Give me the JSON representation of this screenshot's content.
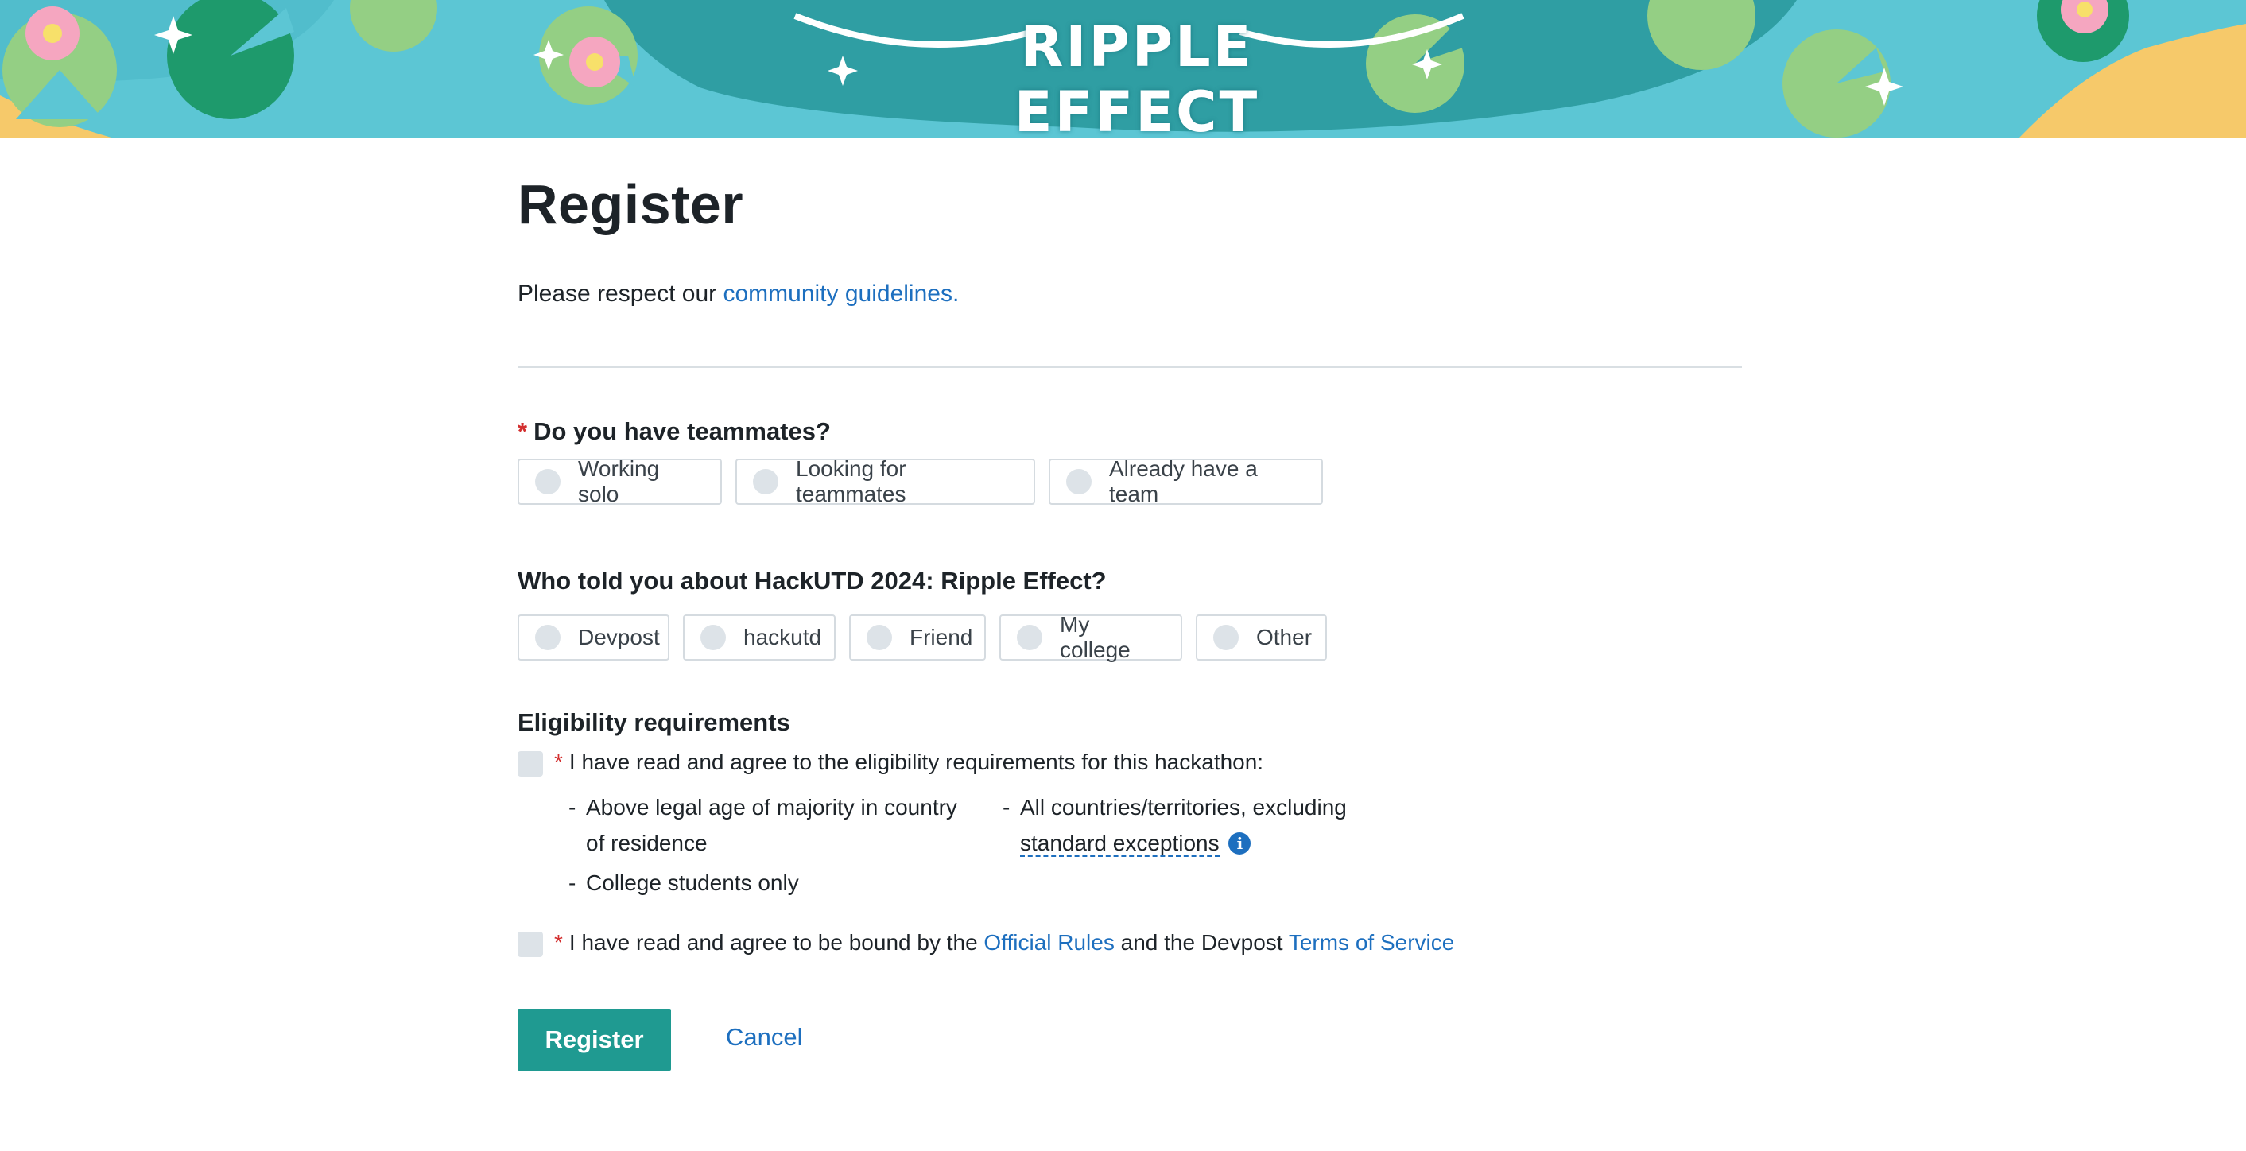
{
  "banner": {
    "title": "RIPPLE EFFECT",
    "colors": {
      "water": "#5cc6d4",
      "deep_water": "#2f9ea3",
      "lily_pad": "#94cf84",
      "lily_pad_dark": "#1e9a6c",
      "sand": "#f6c96a",
      "flower": "#f5a6c0"
    }
  },
  "page": {
    "title": "Register",
    "intro_text": "Please respect our ",
    "intro_link": "community guidelines."
  },
  "teammates": {
    "required_marker": "*",
    "label": "Do you have teammates?",
    "options": [
      "Working solo",
      "Looking for teammates",
      "Already have a team"
    ]
  },
  "referral": {
    "label": "Who told you about HackUTD 2024: Ripple Effect?",
    "options": [
      "Devpost",
      "hackutd",
      "Friend",
      "My college",
      "Other"
    ]
  },
  "eligibility": {
    "heading": "Eligibility requirements",
    "required_marker": "*",
    "agree_text": "I have read and agree to the eligibility requirements for this hackathon:",
    "dash": "-",
    "req_age_line1": "Above legal age of majority in country",
    "req_age_line2": "of residence",
    "req_students": "College students only",
    "req_countries_line1": "All countries/territories, excluding",
    "req_countries_link": "standard exceptions",
    "info_icon_glyph": "i",
    "rules_text_1": "I have read and agree to be bound by the ",
    "rules_link": "Official Rules",
    "rules_text_2": " and the Devpost ",
    "tos_link": "Terms of Service"
  },
  "actions": {
    "register_label": "Register",
    "cancel_label": "Cancel"
  },
  "colors": {
    "accent": "#1f9a91",
    "link": "#1d6fbf",
    "required": "#d32f2f"
  }
}
